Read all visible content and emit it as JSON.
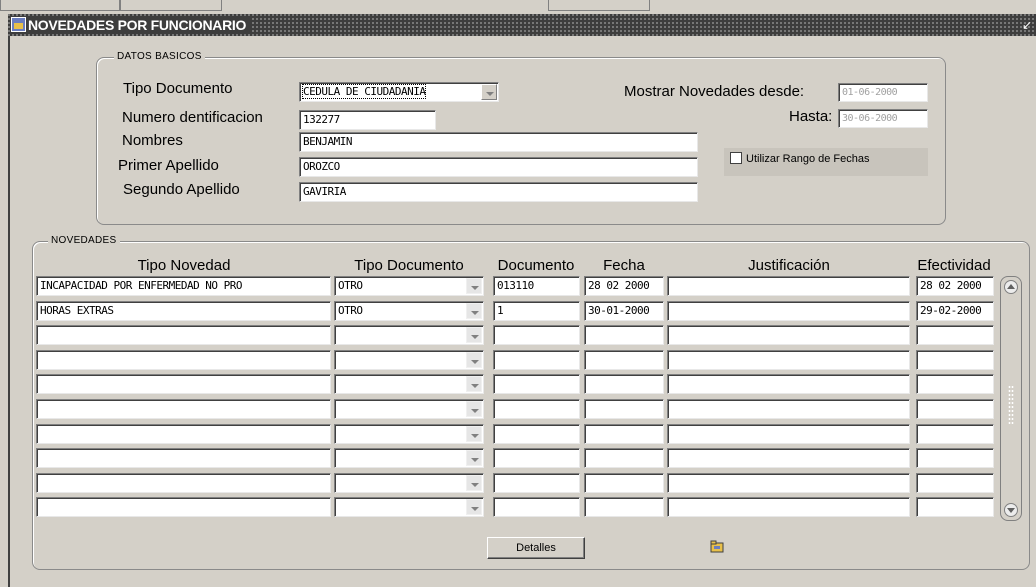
{
  "window": {
    "title": "NOVEDADES POR FUNCIONARIO"
  },
  "datos_basicos": {
    "legend": "DATOS BASICOS",
    "tipo_documento_label": "Tipo Documento",
    "tipo_documento_value": "CEDULA DE CIUDADANIA",
    "numero_label": "Numero dentificacion",
    "numero_value": "132277",
    "nombres_label": "Nombres",
    "nombres_value": "BENJAMIN",
    "primer_apellido_label": "Primer Apellido",
    "primer_apellido_value": "OROZCO",
    "segundo_apellido_label": "Segundo Apellido",
    "segundo_apellido_value": "GAVIRIA",
    "mostrar_label": "Mostrar Novedades desde:",
    "desde_value": "01-06-2000",
    "hasta_label": "Hasta:",
    "hasta_value": "30-06-2000",
    "rango_label": "Utilizar Rango de Fechas"
  },
  "novedades": {
    "legend": "NOVEDADES",
    "columns": [
      "Tipo Novedad",
      "Tipo Documento",
      "Documento",
      "Fecha",
      "Justificación",
      "Efectividad"
    ],
    "rows": [
      {
        "tipo_novedad": "INCAPACIDAD POR ENFERMEDAD NO PRO",
        "tipo_documento": "OTRO",
        "documento": "013110",
        "fecha": "28 02 2000",
        "justificacion": "",
        "efectividad": "28 02 2000"
      },
      {
        "tipo_novedad": "HORAS EXTRAS",
        "tipo_documento": "OTRO",
        "documento": "1",
        "fecha": "30-01-2000",
        "justificacion": "",
        "efectividad": "29-02-2000"
      },
      {
        "tipo_novedad": "",
        "tipo_documento": "",
        "documento": "",
        "fecha": "",
        "justificacion": "",
        "efectividad": ""
      },
      {
        "tipo_novedad": "",
        "tipo_documento": "",
        "documento": "",
        "fecha": "",
        "justificacion": "",
        "efectividad": ""
      },
      {
        "tipo_novedad": "",
        "tipo_documento": "",
        "documento": "",
        "fecha": "",
        "justificacion": "",
        "efectividad": ""
      },
      {
        "tipo_novedad": "",
        "tipo_documento": "",
        "documento": "",
        "fecha": "",
        "justificacion": "",
        "efectividad": ""
      },
      {
        "tipo_novedad": "",
        "tipo_documento": "",
        "documento": "",
        "fecha": "",
        "justificacion": "",
        "efectividad": ""
      },
      {
        "tipo_novedad": "",
        "tipo_documento": "",
        "documento": "",
        "fecha": "",
        "justificacion": "",
        "efectividad": ""
      },
      {
        "tipo_novedad": "",
        "tipo_documento": "",
        "documento": "",
        "fecha": "",
        "justificacion": "",
        "efectividad": ""
      },
      {
        "tipo_novedad": "",
        "tipo_documento": "",
        "documento": "",
        "fecha": "",
        "justificacion": "",
        "efectividad": ""
      }
    ],
    "detalles_label": "Detalles",
    "folder_icon": "folder-icon"
  }
}
